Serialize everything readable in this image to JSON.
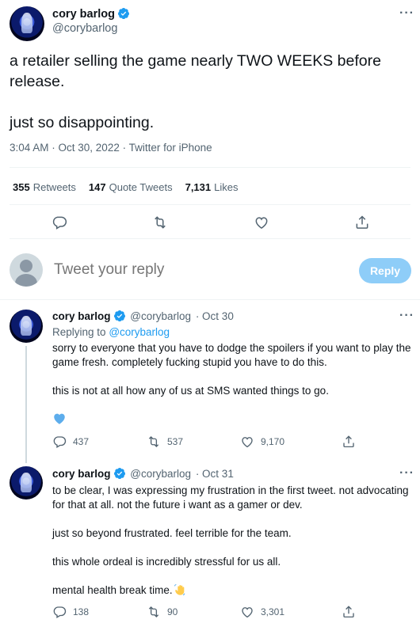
{
  "main_tweet": {
    "author_name": "cory barlog",
    "handle": "@corybarlog",
    "text": "a retailer selling the game nearly TWO WEEKS before release.\n\njust so disappointing.",
    "meta": "3:04 AM · Oct 30, 2022 · Twitter for iPhone",
    "stats": {
      "retweets_count": "355",
      "retweets_label": "Retweets",
      "quotes_count": "147",
      "quotes_label": "Quote Tweets",
      "likes_count": "7,131",
      "likes_label": "Likes"
    },
    "actions": [
      "reply-icon",
      "retweet-icon",
      "like-icon",
      "share-icon"
    ]
  },
  "composer": {
    "placeholder": "Tweet your reply",
    "button_label": "Reply"
  },
  "replies": [
    {
      "author_name": "cory barlog",
      "handle": "@corybarlog",
      "date": "· Oct 30",
      "replying_prefix": "Replying to",
      "replying_handle": "@corybarlog",
      "text": "sorry to everyone that you have to dodge the spoilers if you want to play the game fresh. completely fucking stupid you have to do this.\n\nthis is not at all how any of us at SMS wanted things to go.",
      "reactions": [
        "blue-heart-emoji"
      ],
      "counts": {
        "replies": "437",
        "retweets": "537",
        "likes": "9,170"
      }
    },
    {
      "author_name": "cory barlog",
      "handle": "@corybarlog",
      "date": "· Oct 31",
      "text": "to be clear, I was expressing my frustration in the first tweet. not advocating for that at all. not the future i want as a gamer or dev.\n\njust so beyond frustrated. feel terrible for the team.\n\nthis whole ordeal is incredibly stressful for us all.\n\nmental health break time.",
      "emoji": "waving-hand-emoji",
      "counts": {
        "replies": "138",
        "retweets": "90",
        "likes": "3,301"
      }
    }
  ],
  "colors": {
    "accent": "#1d9bf0",
    "reply_button": "#8ecdf8",
    "muted_text": "#536471",
    "divider": "#eff3f4"
  }
}
